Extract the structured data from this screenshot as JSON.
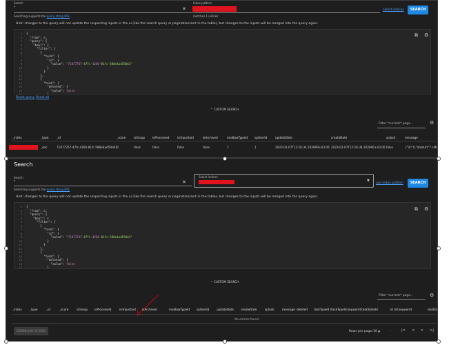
{
  "top": {
    "search_label": "Search",
    "search_value": "*",
    "search_hint_prefix": "Searching supports the",
    "search_hint_link": "query string DSL",
    "index_label": "Index pattern",
    "index_matches": "matches 1 indices",
    "select_indices_link": "select indices",
    "search_button": "SEARCH",
    "hint": "Hint: changes to the query will not update the respecting inputs in the ui (like the search query or pagination/sort in the table), but changes to the inputs will be merged into the query again.",
    "code_lines": [
      "{",
      "  \"from\": 0,",
      "  \"query\": {",
      "    \"bool\": {",
      "      \"filter\": [",
      "        {",
      "          \"term\": {",
      "            \"id\": {",
      "              \"value\": \"71077767-47fc-4260-81fc-588e4ad59d43\"",
      "            }",
      "          }",
      "        },",
      "        {",
      "          \"term\": {",
      "            \"deleted\": {",
      "              \"value\": false",
      "            }",
      "          }",
      "        },"
    ],
    "line_numbers": [
      "1",
      "2",
      "3",
      "4",
      "5",
      "6",
      "7",
      "8",
      "9",
      "10",
      "11",
      "12",
      "13",
      "14",
      "15",
      "16",
      "17",
      "18",
      "19"
    ],
    "reset_query": "Reset query",
    "reset_all": "Reset all",
    "custom_search": "CUSTOM SEARCH",
    "filter_placeholder": "Filter *current* page...",
    "table_headers": [
      "_index",
      "_type",
      "_id",
      "_score",
      "isGroup",
      "isProcessed",
      "isImportant",
      "isArchived",
      "mailboxTypeId",
      "spUserId",
      "updateDate",
      "createDate",
      "splash",
      "message"
    ],
    "row": [
      "",
      "_doc",
      "71077767-47fc-4260-81fc-588e4ad59d43",
      "0",
      "false",
      "false",
      "false",
      "false",
      "1",
      "1",
      "2023-02-07T12:16:34.262890+03:00",
      "2023-02-07T12:16:34.262890+03:00",
      "false",
      "{\"id\":0,\"dataUrl\":\"<Mes"
    ]
  },
  "bottom": {
    "title": "Search",
    "search_label": "Search",
    "search_value": "*",
    "search_hint_prefix": "Searching supports the",
    "search_hint_link": "query string DSL",
    "index_label": "Select indices",
    "use_index_pattern": "use index pattern",
    "search_button": "SEARCH",
    "hint": "Hint: changes to the query will not update the respecting inputs in the ui (like the search query or pagination/sort in the table), but changes to the inputs will be merged into the query again.",
    "code_lines": [
      "{",
      "  \"from\": 0,",
      "  \"query\": {",
      "    \"bool\": {",
      "      \"filter\": [",
      "        {",
      "          \"term\": {",
      "            \"id\": {",
      "              \"value\": \"71077767-47fc-4260-81fc-588e4ad59d43\"",
      "            }",
      "          }",
      "        },",
      "        {",
      "          \"term\": {",
      "            \"deleted\": {",
      "              \"value\": false",
      "            }",
      "          }",
      "        },"
    ],
    "line_numbers": [
      "1",
      "2",
      "3",
      "4",
      "5",
      "6",
      "7",
      "8",
      "9",
      "10",
      "11",
      "12",
      "13",
      "14",
      "15",
      "16",
      "17",
      "18",
      "19"
    ],
    "custom_search": "CUSTOM SEARCH",
    "filter_placeholder": "Filter *current* page...",
    "table_headers": [
      "_index",
      "_type",
      "_id",
      "_score",
      "isGroup",
      "isProcessed",
      "isImportant",
      "isArchived",
      "mailboxTypeId",
      "spUserId",
      "updateDate",
      "createDate",
      "splash",
      "message",
      "deleted",
      "taskTypeId (taskTypeId.keyword)",
      "taskStateId",
      "id (id.keyword)",
      "dueDate"
    ],
    "no_entries": "No entries found.",
    "download_button": "DOWNLOAD AS JSON",
    "rows_per_page_label": "Rows per page:",
    "rows_per_page_value": "10",
    "pager_range": "-",
    "pager_icons": [
      "first-page-icon",
      "prev-page-icon",
      "next-page-icon",
      "last-page-icon"
    ]
  },
  "colors": {
    "accent": "#1e88e5",
    "link": "#4ea1ff",
    "redaction": "#e0141e",
    "annotation_arrow": "#d0021b"
  }
}
